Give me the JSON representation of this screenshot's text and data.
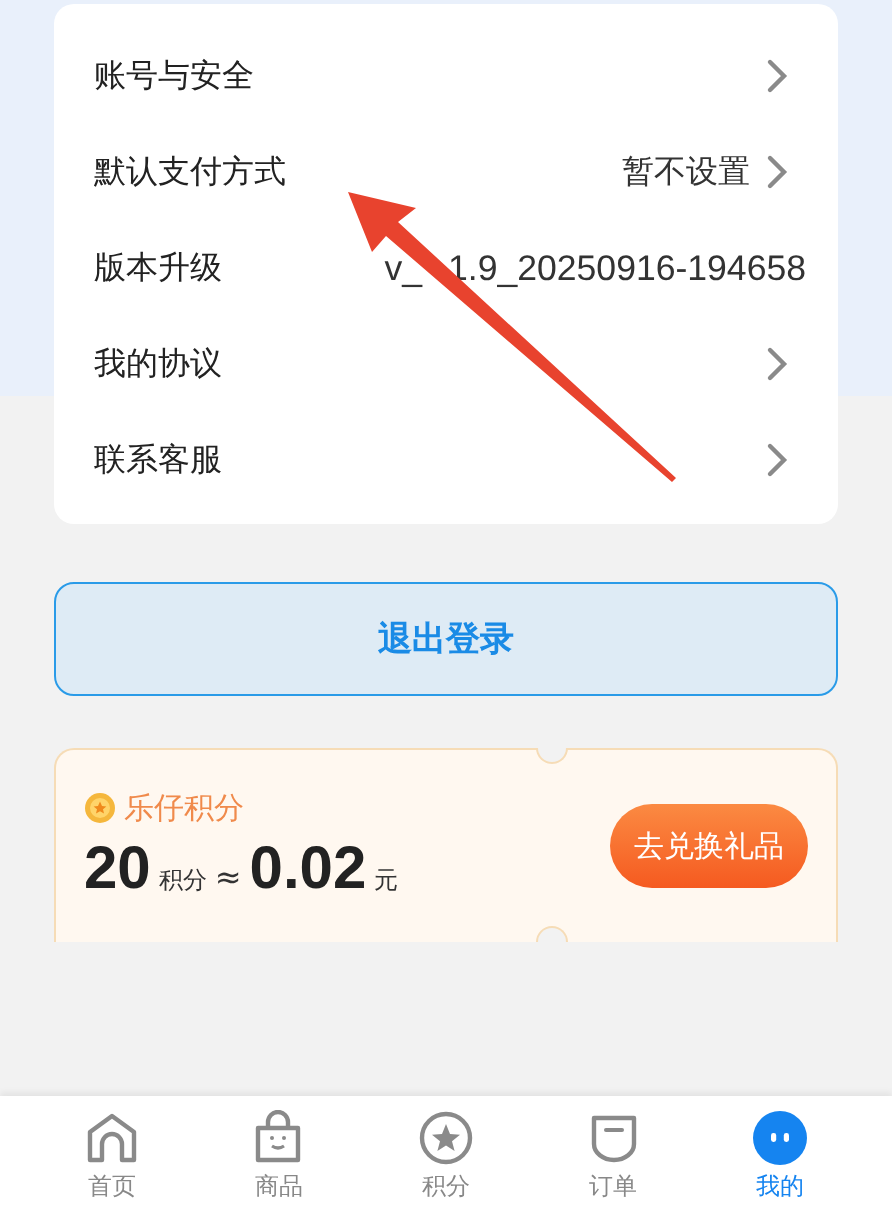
{
  "menu": [
    {
      "label": "账号与安全",
      "chevron": true
    },
    {
      "label": "默认支付方式",
      "value": "暂不设置",
      "chevron": true
    },
    {
      "label": "版本升级",
      "value_parts": [
        "v_",
        "1.9_20250916-194658"
      ],
      "chevron": false
    },
    {
      "label": "我的协议",
      "chevron": true
    },
    {
      "label": "联系客服",
      "chevron": true
    }
  ],
  "logout_button": "退出登录",
  "points": {
    "title": "乐仔积分",
    "amount": "20",
    "unit": "积分",
    "approx": "≈",
    "money": "0.02",
    "currency": "元",
    "button": "去兑换礼品"
  },
  "tabs": [
    {
      "label": "首页",
      "kind": "home",
      "selected": false
    },
    {
      "label": "商品",
      "kind": "bag",
      "selected": false
    },
    {
      "label": "积分",
      "kind": "star",
      "selected": false
    },
    {
      "label": "订单",
      "kind": "cup",
      "selected": false
    },
    {
      "label": "我的",
      "kind": "face",
      "selected": true
    }
  ]
}
